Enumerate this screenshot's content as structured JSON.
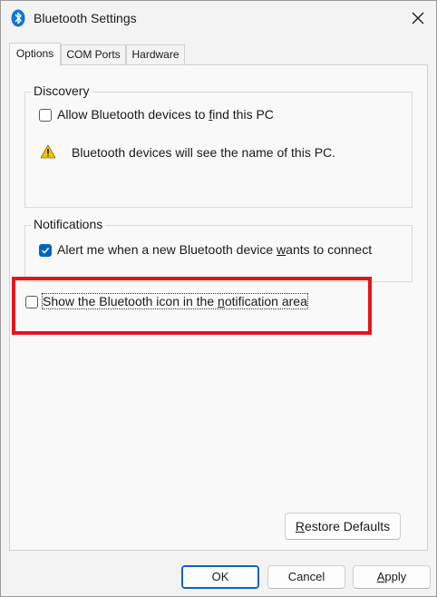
{
  "window": {
    "title": "Bluetooth Settings",
    "icon": "bluetooth-icon",
    "accent_color": "#0067c0"
  },
  "tabs": [
    {
      "label": "Options",
      "active": true
    },
    {
      "label": "COM Ports",
      "active": false
    },
    {
      "label": "Hardware",
      "active": false
    }
  ],
  "discovery": {
    "legend": "Discovery",
    "allow_label_pre": "Allow Bluetooth devices to ",
    "allow_label_accel": "f",
    "allow_label_post": "ind this PC",
    "allow_checked": false,
    "warning_text": "Bluetooth devices will see the name of this PC.",
    "warning_icon": "warning-icon"
  },
  "notifications": {
    "legend": "Notifications",
    "alert_label_pre": "Alert me when a new Bluetooth device ",
    "alert_label_accel": "w",
    "alert_label_post": "ants to connect",
    "alert_checked": true
  },
  "show_icon": {
    "label_pre": "Show the Bluetooth icon in the ",
    "label_accel": "n",
    "label_post": "otification area",
    "checked": false,
    "highlight_color": "#e8141a"
  },
  "buttons": {
    "restore_pre": "",
    "restore_accel": "R",
    "restore_post": "estore Defaults",
    "ok": "OK",
    "cancel": "Cancel",
    "apply_pre": "",
    "apply_accel": "A",
    "apply_post": "pply"
  }
}
